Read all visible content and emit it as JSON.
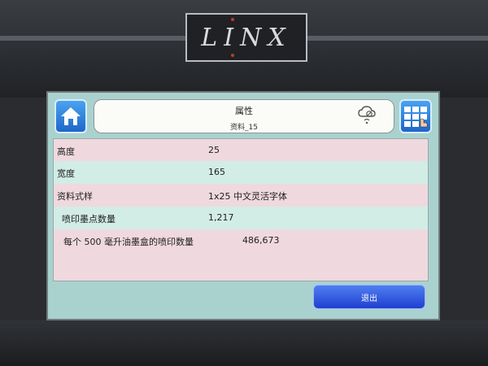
{
  "device": {
    "logo": "LINX"
  },
  "header": {
    "title": "属性",
    "subtitle": "资料_15",
    "status_icon": "cloud-sync-icon"
  },
  "properties": [
    {
      "label": "高度",
      "value": "25"
    },
    {
      "label": "宽度",
      "value": "165"
    },
    {
      "label": "资料式样",
      "value": "1x25 中文灵活字体"
    },
    {
      "label": "喷印墨点数量",
      "value": "1,217"
    },
    {
      "label": "每个 500 毫升油墨盒的喷印数量",
      "value": "486,673"
    }
  ],
  "actions": {
    "exit_label": "退出"
  },
  "colors": {
    "screen_bg": "#a9d2cf",
    "row_pink": "#efd9de",
    "row_green": "#d2ece6",
    "button_blue": "#1f3fd0"
  }
}
